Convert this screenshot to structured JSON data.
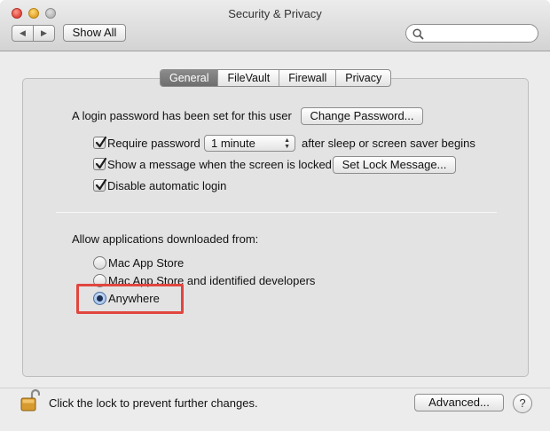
{
  "window": {
    "title": "Security & Privacy"
  },
  "toolbar": {
    "back_icon": "◀",
    "forward_icon": "▶",
    "show_all": "Show All",
    "search_placeholder": ""
  },
  "tabs": [
    {
      "label": "General",
      "active": true
    },
    {
      "label": "FileVault",
      "active": false
    },
    {
      "label": "Firewall",
      "active": false
    },
    {
      "label": "Privacy",
      "active": false
    }
  ],
  "general": {
    "login_text": "A login password has been set for this user",
    "change_password": "Change Password...",
    "require_password": {
      "label": "Require password",
      "checked": true
    },
    "require_delay": "1 minute",
    "after_sleep": "after sleep or screen saver begins",
    "show_message": {
      "label": "Show a message when the screen is locked",
      "checked": true
    },
    "set_lock_message": "Set Lock Message...",
    "disable_autologin": {
      "label": "Disable automatic login",
      "checked": true
    },
    "allow_heading": "Allow applications downloaded from:",
    "allow_options": [
      {
        "label": "Mac App Store",
        "selected": false
      },
      {
        "label": "Mac App Store and identified developers",
        "selected": false
      },
      {
        "label": "Anywhere",
        "selected": true
      }
    ]
  },
  "footer": {
    "lock_text": "Click the lock to prevent further changes.",
    "advanced": "Advanced...",
    "help": "?"
  },
  "colors": {
    "highlight": "#e0463f",
    "active_tab": "#7a7a7a"
  }
}
